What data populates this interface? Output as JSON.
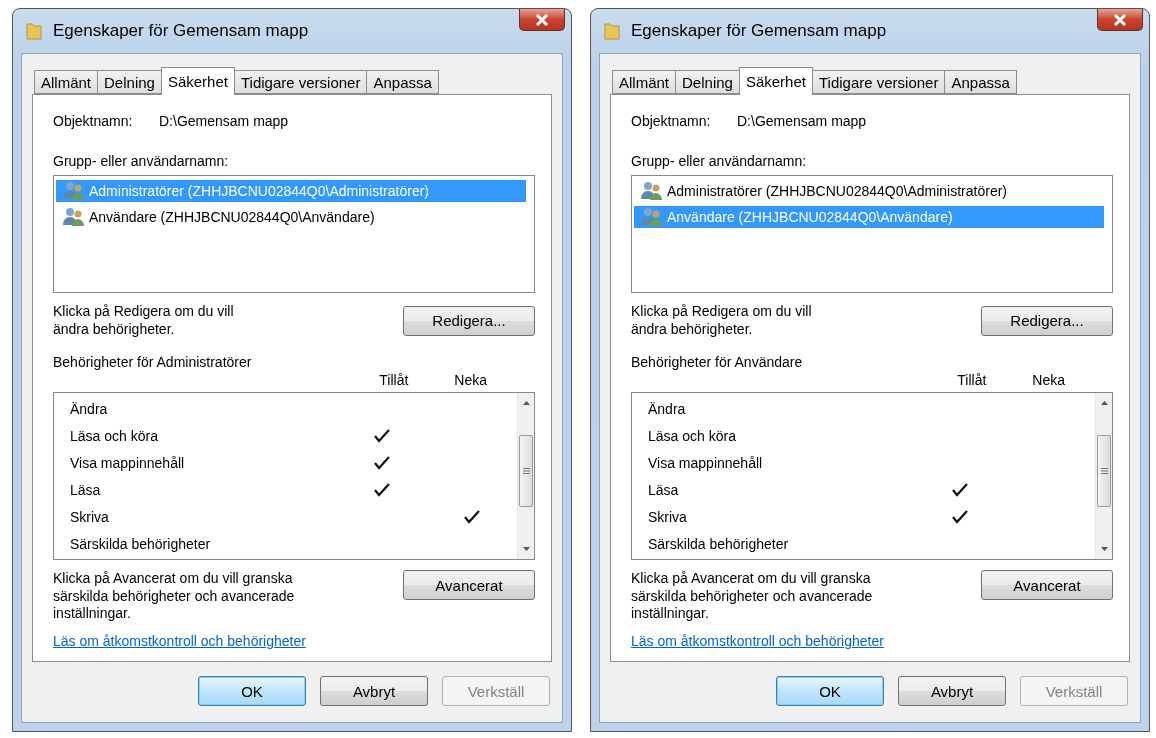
{
  "dialogs": [
    {
      "title": "Egenskaper för Gemensam mapp",
      "tabs": [
        {
          "label": "Allmänt",
          "selected": false
        },
        {
          "label": "Delning",
          "selected": false
        },
        {
          "label": "Säkerhet",
          "selected": true
        },
        {
          "label": "Tidigare versioner",
          "selected": false
        },
        {
          "label": "Anpassa",
          "selected": false
        }
      ],
      "object_label": "Objektnamn:",
      "object_value": "D:\\Gemensam mapp",
      "group_label": "Grupp- eller användarnamn:",
      "principals": [
        {
          "name": "Administratörer (ZHHJBCNU02844Q0\\Administratörer)",
          "selected": true
        },
        {
          "name": "Användare (ZHHJBCNU02844Q0\\Användare)",
          "selected": false
        }
      ],
      "edit_hint": "Klicka på Redigera om du vill ändra behörigheter.",
      "edit_button": "Redigera...",
      "permissions_label": "Behörigheter för Administratörer",
      "columns": [
        "Tillåt",
        "Neka"
      ],
      "permissions": [
        {
          "name": "Ändra",
          "allow": false,
          "deny": false
        },
        {
          "name": "Läsa och köra",
          "allow": true,
          "deny": false
        },
        {
          "name": "Visa mappinnehåll",
          "allow": true,
          "deny": false
        },
        {
          "name": "Läsa",
          "allow": true,
          "deny": false
        },
        {
          "name": "Skriva",
          "allow": false,
          "deny": true
        },
        {
          "name": "Särskilda behörigheter",
          "allow": false,
          "deny": false
        }
      ],
      "advanced_hint": "Klicka på Avancerat om du vill granska särskilda behörigheter och avancerade inställningar.",
      "advanced_button": "Avancerat",
      "link": "Läs om åtkomstkontroll och behörigheter",
      "buttons": [
        {
          "label": "OK",
          "default": true,
          "disabled": false
        },
        {
          "label": "Avbryt",
          "default": false,
          "disabled": false
        },
        {
          "label": "Verkställ",
          "default": false,
          "disabled": true
        }
      ]
    },
    {
      "title": "Egenskaper för Gemensam mapp",
      "tabs": [
        {
          "label": "Allmänt",
          "selected": false
        },
        {
          "label": "Delning",
          "selected": false
        },
        {
          "label": "Säkerhet",
          "selected": true
        },
        {
          "label": "Tidigare versioner",
          "selected": false
        },
        {
          "label": "Anpassa",
          "selected": false
        }
      ],
      "object_label": "Objektnamn:",
      "object_value": "D:\\Gemensam mapp",
      "group_label": "Grupp- eller användarnamn:",
      "principals": [
        {
          "name": "Administratörer (ZHHJBCNU02844Q0\\Administratörer)",
          "selected": false
        },
        {
          "name": "Användare (ZHHJBCNU02844Q0\\Användare)",
          "selected": true
        }
      ],
      "edit_hint": "Klicka på Redigera om du vill ändra behörigheter.",
      "edit_button": "Redigera...",
      "permissions_label": "Behörigheter för Användare",
      "columns": [
        "Tillåt",
        "Neka"
      ],
      "permissions": [
        {
          "name": "Ändra",
          "allow": false,
          "deny": false
        },
        {
          "name": "Läsa och köra",
          "allow": false,
          "deny": false
        },
        {
          "name": "Visa mappinnehåll",
          "allow": false,
          "deny": false
        },
        {
          "name": "Läsa",
          "allow": true,
          "deny": false
        },
        {
          "name": "Skriva",
          "allow": true,
          "deny": false
        },
        {
          "name": "Särskilda behörigheter",
          "allow": false,
          "deny": false
        }
      ],
      "advanced_hint": "Klicka på Avancerat om du vill granska särskilda behörigheter och avancerade inställningar.",
      "advanced_button": "Avancerat",
      "link": "Läs om åtkomstkontroll och behörigheter",
      "buttons": [
        {
          "label": "OK",
          "default": true,
          "disabled": false
        },
        {
          "label": "Avbryt",
          "default": false,
          "disabled": false
        },
        {
          "label": "Verkställ",
          "default": false,
          "disabled": true
        }
      ]
    }
  ]
}
